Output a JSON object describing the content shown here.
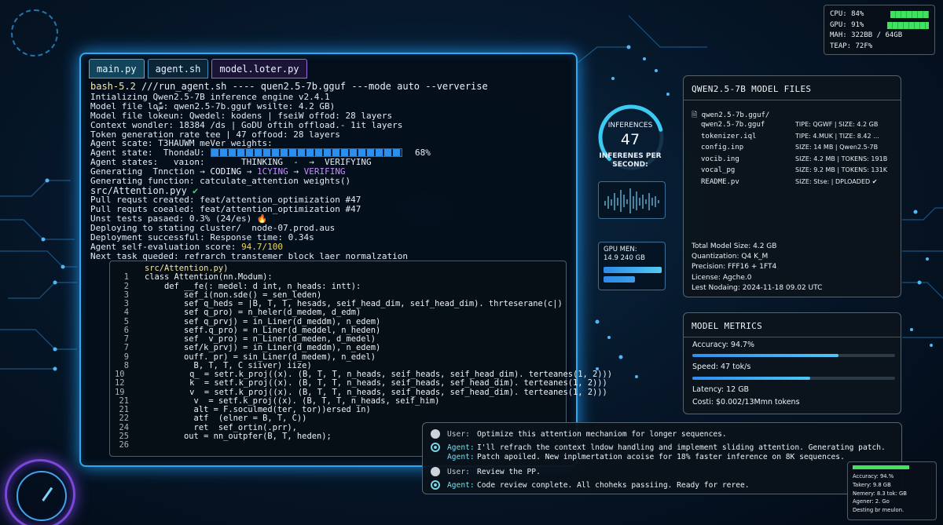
{
  "terminal": {
    "tabs": [
      "main.py",
      "agent.sh",
      "model.loter.py"
    ],
    "prompt": "bash-5.2",
    "command": " ///run_agent.sh ---- quen2.5-7b.gguf ---mode auto --ververise",
    "log": [
      "Intializing Qwen2.5-7B inference engine v2.4.1",
      "Model file loسّّ: qwen2.5-7b.gguf wѕilte: 4.2 GB)",
      "Model file lokeun: Qwedel: kodens | fseiW offod: 28 layers",
      "Context wondler: 18384 /ds | GoDU oftih offload.- 1it layers",
      "Token generation rate tee | 47 offood: 28 layers",
      "Agent scate: T3HAUWM meVer weights:"
    ],
    "agent_state_label": "Agent state:  ThondaU:",
    "progress_pct": 68,
    "progress_text": "68%",
    "states_label": "Agent states:   ѵаıon:",
    "states_think": "THINKING",
    "states_arrow1": "  -  →  ",
    "states_verif1": "VERIFYING",
    "gen_prefix": "Generating  Tnnction → ",
    "gen_coding": "CODING",
    "gen_arrow2": " → ",
    "gen_cying": "1CYING",
    "gen_arrow3": " → ",
    "gen_verif": "VERIFING",
    "gen_func": "Generating function: catculate_attention weights()",
    "src_file": "src/Attention.pyy",
    "src_check": " ✔",
    "log2": [
      "Pull requst created: feat/attention_optimization #47",
      "Pull requts coealed: feat/attention_optimization #47"
    ],
    "tests": "Unst tests pasaed: 0.3% (24/es) ",
    "tests_icon": "🔥",
    "log3": [
      "Deploying to stating cluster/  node-07.prod.aus",
      "Deployment successful: Response time: 0.34s"
    ],
    "score_prefix": "Agent self-evaluation score: ",
    "score_value": "94.7/100",
    "next_task": "Next task queded: refrarch transtemer block laer normalzation"
  },
  "editor": {
    "header": "src/Attention.py)",
    "lines": [
      [
        "1",
        "class Attention(nn.Modum):"
      ],
      [
        "2",
        "    def __fe(: medel: d int, n_heads: intt):"
      ],
      [
        "3",
        "        sef_i(non.sde() = sen_leden)"
      ],
      [
        "3",
        "        sef q_heds = |B, T, T, hesads, seif_head_dim, seif_head_dim). thrteserane(c|)"
      ],
      [
        "4",
        "        sef q_pro) = n_heler(d_medem, d_edm)"
      ],
      [
        "5",
        "        sef q_prvj) = in_Liner(d_meddm), n_edem)"
      ],
      [
        "6",
        "        seff.q_pro) = n_Liner(d_meddel, n_heden)"
      ],
      [
        "7",
        "        sef  v_pro) = n_Liner(d_meden, d_medel)"
      ],
      [
        "7",
        "        sef/k_prvj) = in_Liner(d_meddm), n_edem)"
      ],
      [
        "9",
        "        ouff. pr) = sin_Liner(d_medem), n_edel)"
      ],
      [
        "8",
        "          B, T, T, C siiver) iize)"
      ],
      [
        "10",
        "          q_ = setr.k_proj((x). (B, T, T, n_heads, seif_heads, seif_head_dim). terteanes(1, 2)))"
      ],
      [
        "12",
        "          k  = setf.k_proj((x). (B, T, T, n_heads, seif_heads, sef_head_dim). terteanes(1, 2)))"
      ],
      [
        "19",
        "          v  = setf.k_proj((x). (B, T, T, n_heads, seif_heads, sef_head_dim). terteanes(1, 2)))"
      ],
      [
        "21",
        "          v  = setf.k_proj((x). (B, T, T, n_heads, seif_him)"
      ],
      [
        "21",
        "          alt = F.soculmed(ter, tor))ersed in)"
      ],
      [
        "22",
        "          atf  (elner = B, T, C))"
      ],
      [
        "24",
        "          ret  sef_ortin(.prr),"
      ],
      [
        "25",
        "        out = nn_outpfer(B, T, heden);"
      ],
      [
        "26",
        ""
      ]
    ]
  },
  "inference": {
    "label": "INFERENCES",
    "value": "47",
    "sub1": "INFERENES PER",
    "sub2": "SECOND:",
    "gauge_fraction": 0.78
  },
  "gpu": {
    "label": "GPU MEN:",
    "value": "14.9 240 GB"
  },
  "files": {
    "title": "QWEN2.5-7B MODEL FILES",
    "root": "qwen2.5-7b.gguf/",
    "rows": [
      {
        "name": "qwen2.5-7b.gguf",
        "meta": "TIPE: QGWF | SIZE: 4.2 GB"
      },
      {
        "name": "tokenizer.iql",
        "meta": "TIPE: 4.MUK | TIZE: 8.42 ..."
      },
      {
        "name": "config.inp",
        "meta": "SIZE: 14 MB | Qwen2.5-7B"
      },
      {
        "name": "vocib.ing",
        "meta": "SIZE: 4.2 MB | TOKENS: 191B"
      },
      {
        "name": "vocal_pg",
        "meta": "SIZE: 9.2 MB | TOKENS: 131K"
      },
      {
        "name": "README.pv",
        "meta": "SIZE: Stse: | DPLOADED ✔"
      }
    ],
    "info": [
      "Total Model Size: 4.2 GB",
      "Quantization: Q4 K_M",
      "Precision: FFF16 + 1FT4",
      "License: Agche.0",
      "Lest Nodaing: 2024-11-18 09.02 UTC"
    ]
  },
  "metrics": {
    "title": "MODEL METRICS",
    "accuracy": "Accuracy: 94.7%",
    "accuracy_fraction": 0.72,
    "speed": "Speed: 47 tok/s",
    "speed_fraction": 0.58,
    "latency": "Latency: 12 GB",
    "cost": "Costi: $0.002/13Mmn tokens"
  },
  "chat": [
    {
      "who": "User:",
      "role": "user",
      "text": "Optimize this attention mechaniom for longer sequences."
    },
    {
      "who": "Agent:",
      "role": "agent",
      "text": "I'll refrach the context lndow handling and implement sliding attention. Generating patch."
    },
    {
      "who": "Agent:",
      "role": "agent",
      "text": "Patch apoiled. New inplmertation acoise for 18% faster inference on 8K sequences.",
      "no_icon": true
    },
    {
      "who": "User:",
      "role": "user",
      "text": "Review the PP."
    },
    {
      "who": "Agent:",
      "role": "agent",
      "text": "Code review conplete. All choheks passiing. Ready for reree."
    }
  ],
  "sys": {
    "cpu": "CPU: 84%",
    "gpu": "GPU: 91%",
    "mah": "MAH: 322BB / 64GB",
    "teap": "TEAP: 72F%",
    "cpu_fraction": 0.84,
    "gpu_fraction": 0.91
  },
  "mini": {
    "rows": [
      "Accuracy: 94.%",
      "Takery: 9.8 GB",
      "Nemery: 8.3 tok: GB",
      "Agener: 2. Go",
      "Desting br meulon."
    ]
  },
  "colors": {
    "accent": "#2fa8f0",
    "green": "#3fe35f",
    "purple": "#9a6ad6"
  }
}
